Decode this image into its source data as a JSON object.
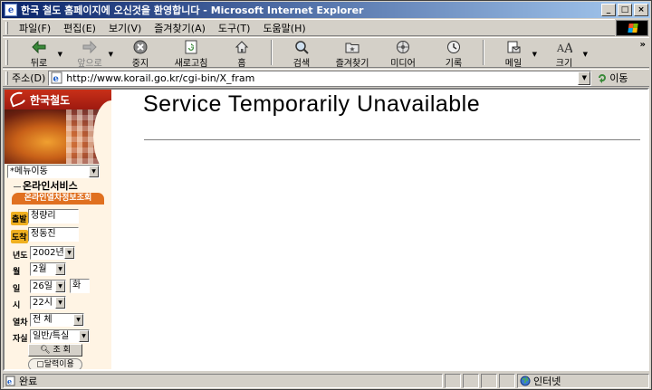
{
  "window": {
    "title": "한국 철도 홈페이지에 오신것을 환영합니다 - Microsoft Internet Explorer",
    "controls": {
      "minimize": "_",
      "maximize": "□",
      "close": "×"
    }
  },
  "menubar": {
    "items": [
      "파일(F)",
      "편집(E)",
      "보기(V)",
      "즐겨찾기(A)",
      "도구(T)",
      "도움말(H)"
    ]
  },
  "toolbar": {
    "back": "뒤로",
    "forward": "앞으로",
    "stop": "중지",
    "refresh": "새로고침",
    "home": "홈",
    "search": "검색",
    "favorites": "즐겨찾기",
    "media": "미디어",
    "history": "기록",
    "mail": "메일",
    "size": "크기",
    "more": "»"
  },
  "addressbar": {
    "label": "주소(D)",
    "url": "http://www.korail.go.kr/cgi-bin/X_fram",
    "go": "이동"
  },
  "sidebar": {
    "brand": "한국철도",
    "menu_select": "*메뉴이동",
    "section_title": "온라인서비스",
    "tab_title": "온라인열차정보조회",
    "departure_label": "출발",
    "departure_value": "청량리",
    "arrival_label": "도착",
    "arrival_value": "정동진",
    "year_label": "년도",
    "year_value": "2002년",
    "month_label": "월",
    "month_value": "2월",
    "day_label": "일",
    "day_value": "26일",
    "weekday_value": "화",
    "hour_label": "시",
    "hour_value": "22시",
    "train_label": "열차",
    "train_value": "전 체",
    "seat_label": "자실",
    "seat_value": "일반/특실",
    "search_button": "조 회",
    "calendar_button": "달력이용"
  },
  "main": {
    "heading": "Service Temporarily Unavailable"
  },
  "statusbar": {
    "status": "완료",
    "zone": "인터넷"
  }
}
